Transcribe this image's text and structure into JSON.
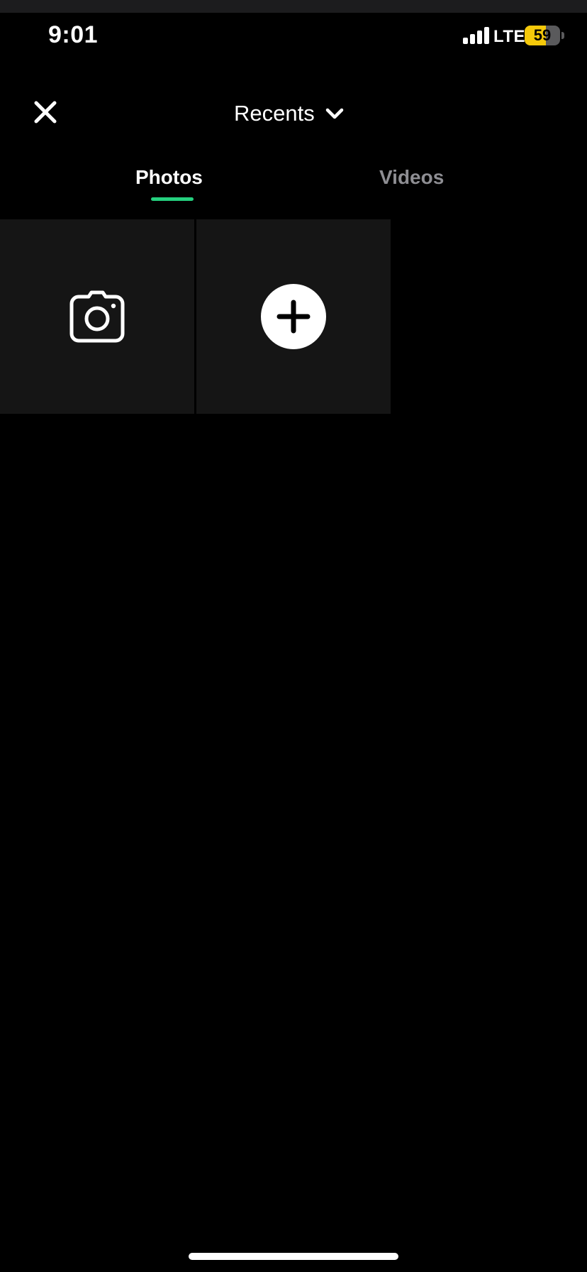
{
  "status_bar": {
    "time": "9:01",
    "network": "LTE",
    "battery_level": "59",
    "battery_fraction": 0.59,
    "signal_bars": 4
  },
  "header": {
    "close_icon": "close-icon",
    "title": "Recents",
    "title_dropdown_icon": "chevron-down-icon"
  },
  "tabs": [
    {
      "label": "Photos",
      "selected": true
    },
    {
      "label": "Videos",
      "selected": false
    }
  ],
  "grid": {
    "tiles": [
      {
        "icon": "camera-icon"
      },
      {
        "icon": "plus-circle-icon"
      }
    ]
  },
  "colors": {
    "background": "#000000",
    "tile_background": "#151515",
    "accent": "#25d07f",
    "inactive_tab": "#8e8e93",
    "battery_fill": "#f5c90a"
  }
}
